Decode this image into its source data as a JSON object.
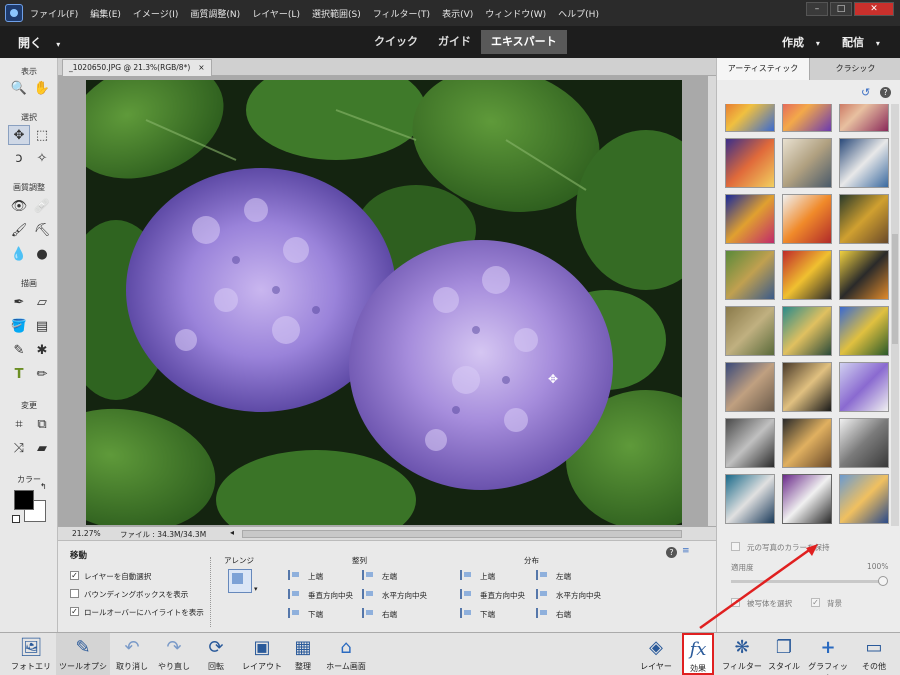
{
  "menu": [
    "ファイル(F)",
    "編集(E)",
    "イメージ(I)",
    "画質調整(N)",
    "レイヤー(L)",
    "選択範囲(S)",
    "フィルター(T)",
    "表示(V)",
    "ウィンドウ(W)",
    "ヘルプ(H)"
  ],
  "window_controls": {
    "minimize": "–",
    "maximize": "□",
    "close": "✕"
  },
  "modebar": {
    "open": "開く",
    "tabs": [
      "クイック",
      "ガイド",
      "エキスパート"
    ],
    "active_tab": "エキスパート",
    "create": "作成",
    "share": "配信"
  },
  "toolbox": {
    "sections": {
      "view": "表示",
      "select": "選択",
      "enhance": "画質調整",
      "draw": "描画",
      "modify": "変更",
      "color": "カラー"
    },
    "fg_color": "#000000",
    "bg_color": "#ffffff"
  },
  "document": {
    "tab_title": "_1020650.JPG @ 21.3%(RGB/8*)",
    "tab_close": "×",
    "zoom": "21.27%",
    "file_info": "ファイル : 34.3M/34.3M"
  },
  "options": {
    "title": "移動",
    "checkboxes": [
      {
        "label": "レイヤーを自動選択",
        "checked": true
      },
      {
        "label": "バウンディングボックスを表示",
        "checked": false
      },
      {
        "label": "ロールオーバーにハイライトを表示",
        "checked": true
      }
    ],
    "arrange_label": "アレンジ",
    "align_label": "整列",
    "distribute_label": "分布",
    "align_items": [
      "上端",
      "左端",
      "垂直方向中央",
      "水平方向中央",
      "下端",
      "右端"
    ],
    "distribute_items": [
      "上端",
      "左端",
      "垂直方向中央",
      "水平方向中央",
      "下端",
      "右端"
    ]
  },
  "right_panel": {
    "tab_artistic": "アーティスティック",
    "tab_classic": "クラシック",
    "help": "?",
    "keep_original": "元の写真のカラーを保持",
    "keep_original_checked": false,
    "amount_label": "適用度",
    "amount_value": "100%",
    "amount": 1.0,
    "select_subject": "被写体を選択",
    "select_subject_checked": true,
    "background": "背景",
    "background_checked": true
  },
  "bottombar": {
    "photo_bin": "フォトエリア",
    "tool_options": "ツールオプション",
    "undo": "取り消し",
    "redo": "やり直し",
    "rotate": "回転",
    "layout": "レイアウト",
    "organize": "整理",
    "home": "ホーム画面",
    "layers": "レイヤー",
    "effects": "効果",
    "effects_glyph": "fx",
    "filters": "フィルター",
    "styles": "スタイル",
    "graphics": "グラフィック",
    "more": "その他"
  },
  "colors": {
    "accent": "#e02020",
    "active_tab_bg": "#595959"
  }
}
